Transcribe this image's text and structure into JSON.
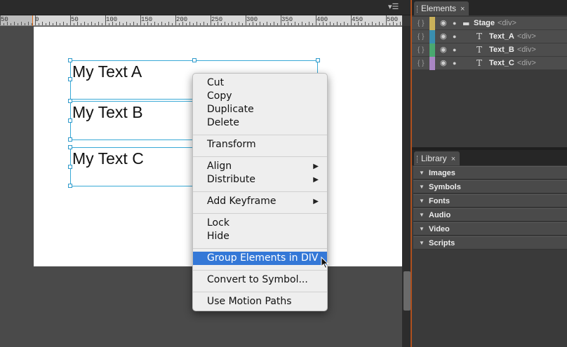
{
  "ruler": {
    "labels": [
      "50",
      "0",
      "50",
      "100",
      "150",
      "200",
      "250",
      "300",
      "350",
      "400",
      "450",
      "500"
    ]
  },
  "stage": {
    "elements": [
      {
        "text": "My Text A"
      },
      {
        "text": "My Text B"
      },
      {
        "text": "My Text C"
      }
    ]
  },
  "context_menu": {
    "items": [
      {
        "label": "Cut"
      },
      {
        "label": "Copy"
      },
      {
        "label": "Duplicate"
      },
      {
        "label": "Delete"
      },
      {
        "label": "Transform"
      },
      {
        "label": "Align",
        "submenu": true
      },
      {
        "label": "Distribute",
        "submenu": true
      },
      {
        "label": "Add Keyframe",
        "submenu": true
      },
      {
        "label": "Lock"
      },
      {
        "label": "Hide"
      },
      {
        "label": "Group Elements in DIV",
        "highlighted": true
      },
      {
        "label": "Convert to Symbol..."
      },
      {
        "label": "Use Motion Paths"
      }
    ],
    "submenu_arrow": "▶",
    "highlight_color": "#3478d7"
  },
  "elements_panel": {
    "tab_label": "Elements",
    "close": "×",
    "rows": [
      {
        "name": "Stage",
        "tag": "<div>",
        "color": "#c9b15a",
        "type_icon": "folder-icon"
      },
      {
        "name": "Text_A",
        "tag": "<div>",
        "color": "#3a8fb0",
        "type_icon": "text-type-icon"
      },
      {
        "name": "Text_B",
        "tag": "<div>",
        "color": "#4aa870",
        "type_icon": "text-type-icon"
      },
      {
        "name": "Text_C",
        "tag": "<div>",
        "color": "#a986c4",
        "type_icon": "text-type-icon"
      }
    ]
  },
  "library_panel": {
    "tab_label": "Library",
    "close": "×",
    "sections": [
      "Images",
      "Symbols",
      "Fonts",
      "Audio",
      "Video",
      "Scripts"
    ]
  }
}
